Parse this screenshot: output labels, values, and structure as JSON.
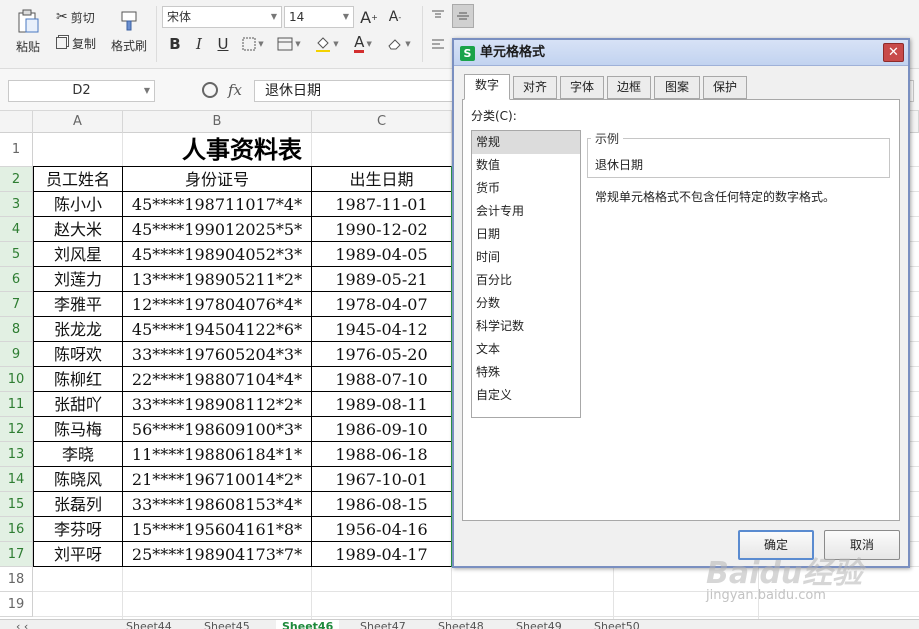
{
  "ribbon": {
    "paste_label": "粘贴",
    "cut_label": "剪切",
    "copy_label": "复制",
    "format_painter_label": "格式刷",
    "font_name": "宋体",
    "font_size": "14",
    "number_format": "常规"
  },
  "formula_bar": {
    "name_box": "D2",
    "fx_label": "fx",
    "formula_value": "退休日期"
  },
  "columns": [
    "A",
    "B",
    "C"
  ],
  "rows": [
    "1",
    "2",
    "3",
    "4",
    "5",
    "6",
    "7",
    "8",
    "9",
    "10",
    "11",
    "12",
    "13",
    "14",
    "15",
    "16",
    "17",
    "18",
    "19"
  ],
  "sheet": {
    "title": "人事资料表",
    "headers": [
      "员工姓名",
      "身份证号",
      "出生日期"
    ],
    "records": [
      [
        "陈小小",
        "45****198711017*4*",
        "1987-11-01"
      ],
      [
        "赵大米",
        "45****199012025*5*",
        "1990-12-02"
      ],
      [
        "刘风星",
        "45****198904052*3*",
        "1989-04-05"
      ],
      [
        "刘莲力",
        "13****198905211*2*",
        "1989-05-21"
      ],
      [
        "李雅平",
        "12****197804076*4*",
        "1978-04-07"
      ],
      [
        "张龙龙",
        "45****194504122*6*",
        "1945-04-12"
      ],
      [
        "陈呀欢",
        "33****197605204*3*",
        "1976-05-20"
      ],
      [
        "陈柳红",
        "22****198807104*4*",
        "1988-07-10"
      ],
      [
        "张甜吖",
        "33****198908112*2*",
        "1989-08-11"
      ],
      [
        "陈马梅",
        "56****198609100*3*",
        "1986-09-10"
      ],
      [
        "李晓",
        "11****198806184*1*",
        "1988-06-18"
      ],
      [
        "陈晓风",
        "21****196710014*2*",
        "1967-10-01"
      ],
      [
        "张磊列",
        "33****198608153*4*",
        "1986-08-15"
      ],
      [
        "李芬呀",
        "15****195604161*8*",
        "1956-04-16"
      ],
      [
        "刘平呀",
        "25****198904173*7*",
        "1989-04-17"
      ]
    ]
  },
  "sheet_tabs": [
    "Sheet44",
    "Sheet45",
    "Sheet46",
    "Sheet47",
    "Sheet48",
    "Sheet49",
    "Sheet50"
  ],
  "active_sheet_tab": "Sheet46",
  "dialog": {
    "title": "单元格格式",
    "app_icon": "S",
    "tabs": [
      "数字",
      "对齐",
      "字体",
      "边框",
      "图案",
      "保护"
    ],
    "active_tab": "数字",
    "category_label": "分类(C):",
    "categories": [
      "常规",
      "数值",
      "货币",
      "会计专用",
      "日期",
      "时间",
      "百分比",
      "分数",
      "科学记数",
      "文本",
      "特殊",
      "自定义"
    ],
    "selected_category": "常规",
    "sample_label": "示例",
    "sample_value": "退休日期",
    "description": "常规单元格格式不包含任何特定的数字格式。",
    "ok_label": "确定",
    "cancel_label": "取消"
  },
  "watermark": {
    "logo": "Baidu经验",
    "url": "jingyan.baidu.com"
  },
  "colors": {
    "accent_green": "#1e8a3c",
    "dialog_border": "#7a8fc0",
    "close_red": "#c84a4a"
  }
}
